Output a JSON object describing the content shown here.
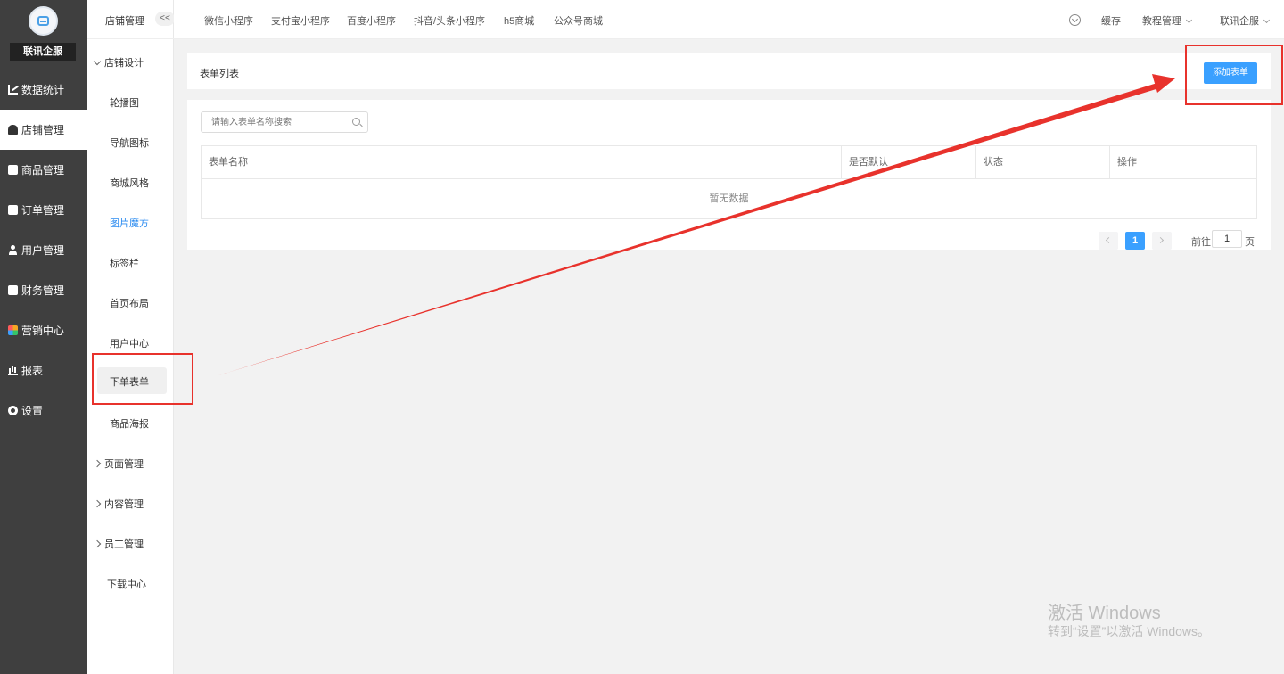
{
  "brand": {
    "name": "联讯企服"
  },
  "main_nav": [
    {
      "label": "数据统计",
      "icon": "chart-icon"
    },
    {
      "label": "店铺管理",
      "icon": "store-icon",
      "active": true
    },
    {
      "label": "商品管理",
      "icon": "goods-icon"
    },
    {
      "label": "订单管理",
      "icon": "order-icon"
    },
    {
      "label": "用户管理",
      "icon": "user-icon"
    },
    {
      "label": "财务管理",
      "icon": "finance-icon"
    },
    {
      "label": "营销中心",
      "icon": "marketing-icon"
    },
    {
      "label": "报表",
      "icon": "report-icon"
    },
    {
      "label": "设置",
      "icon": "settings-icon"
    }
  ],
  "sub_nav": {
    "title": "店铺管理",
    "collapse": "<<",
    "group_open": "店铺设计",
    "items": [
      "轮播图",
      "导航图标",
      "商城风格",
      "图片魔方",
      "标签栏",
      "首页布局",
      "用户中心",
      "下单表单",
      "商品海报"
    ],
    "groups": [
      "页面管理",
      "内容管理",
      "员工管理"
    ],
    "download": "下载中心"
  },
  "topbar": {
    "tabs": [
      "微信小程序",
      "支付宝小程序",
      "百度小程序",
      "抖音/头条小程序",
      "h5商城",
      "公众号商城"
    ],
    "cache": "缓存",
    "tutorial": "教程管理",
    "account": "联讯企服"
  },
  "page": {
    "title": "表单列表",
    "add_button": "添加表单",
    "search_placeholder": "请输入表单名称搜索",
    "columns": [
      "表单名称",
      "是否默认",
      "状态",
      "操作"
    ],
    "empty_text": "暂无数据",
    "pagination": {
      "current": "1",
      "goto_prefix": "前往",
      "goto_value": "1",
      "goto_suffix": "页"
    }
  },
  "watermark": {
    "line1": "激活 Windows",
    "line2": "转到“设置”以激活 Windows。"
  },
  "colors": {
    "accent": "#3aa0ff",
    "sidebar": "#3f3f3f",
    "annotation": "#e8322c"
  }
}
